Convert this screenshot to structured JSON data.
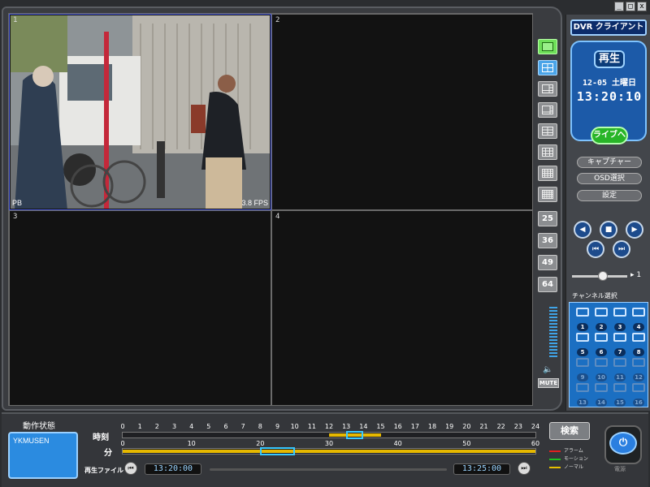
{
  "window_controls": [
    "_",
    "□",
    "x"
  ],
  "app": {
    "title": "DVR クライアント"
  },
  "clock": {
    "mode": "再生",
    "date": "12-05 土曜日",
    "time": "13:20:10",
    "live_button": "ライブへ"
  },
  "side_buttons": {
    "capture": "キャプチャー",
    "osd": "OSD選択",
    "settings": "設定"
  },
  "video": {
    "cells": [
      {
        "num": "1",
        "overlay_left": "PB",
        "overlay_right": "3.8 FPS",
        "active": true
      },
      {
        "num": "2"
      },
      {
        "num": "3"
      },
      {
        "num": "4"
      }
    ]
  },
  "layout_buttons": {
    "count_labels": [
      "25",
      "36",
      "49",
      "64"
    ],
    "mute": "MUTE"
  },
  "playback": {
    "speed_value": "1"
  },
  "channel_select": {
    "title": "チャンネル選択",
    "channels": [
      "1",
      "2",
      "3",
      "4",
      "5",
      "6",
      "7",
      "8",
      "9",
      "10",
      "11",
      "12",
      "13",
      "14",
      "15",
      "16"
    ],
    "active_count": 8
  },
  "status": {
    "label": "動作状態",
    "value": "YKMUSEN"
  },
  "timeline": {
    "hour_label": "時刻",
    "minute_label": "分",
    "hour_ticks": [
      "0",
      "1",
      "2",
      "3",
      "4",
      "5",
      "6",
      "7",
      "8",
      "9",
      "10",
      "11",
      "12",
      "13",
      "14",
      "15",
      "16",
      "17",
      "18",
      "19",
      "20",
      "21",
      "22",
      "23",
      "24"
    ],
    "minute_ticks": [
      "0",
      "10",
      "20",
      "30",
      "40",
      "50",
      "60"
    ],
    "hour_recorded": [
      12,
      15
    ],
    "hour_cursor": [
      13,
      14
    ],
    "minute_recorded": [
      0,
      60
    ],
    "minute_cursor": [
      20,
      25
    ],
    "search_button": "検索",
    "legend": [
      {
        "label": "アラーム",
        "color": "#e02020"
      },
      {
        "label": "モーション",
        "color": "#20c020"
      },
      {
        "label": "ノーマル",
        "color": "#e6c000"
      }
    ]
  },
  "file": {
    "label": "再生ファイル",
    "start": "13:20:00",
    "end": "13:25:00"
  },
  "power": {
    "label": "電源"
  }
}
